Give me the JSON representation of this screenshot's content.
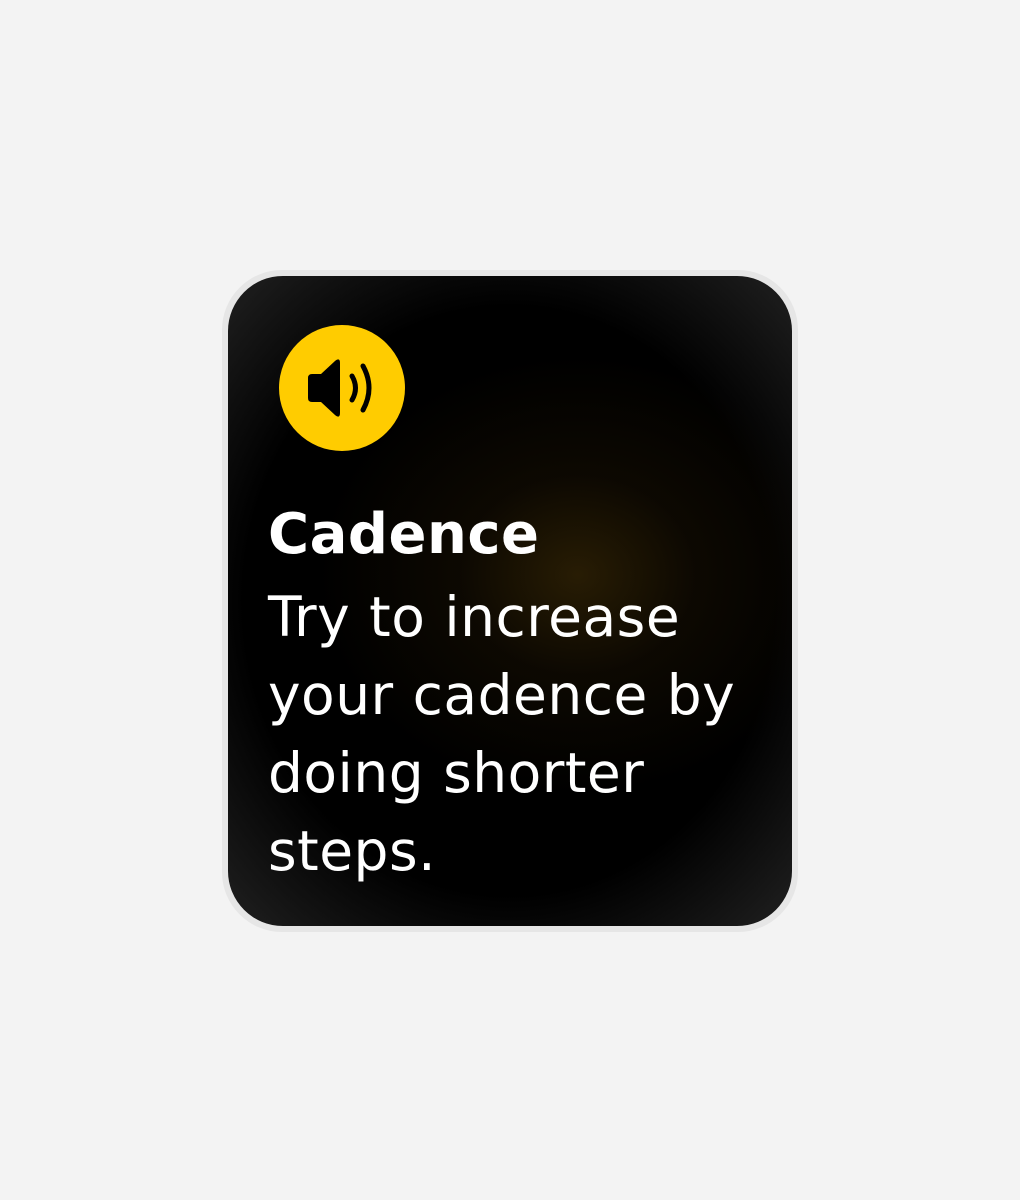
{
  "notification": {
    "icon": "speaker-wave-icon",
    "title": "Cadence",
    "message": "Try to increase your cadence by doing shorter steps."
  },
  "colors": {
    "page_background": "#f3f3f3",
    "bezel": "#e6e6e6",
    "screen": "#000000",
    "accent": "#ffcc00",
    "icon_glyph": "#000000",
    "text": "#ffffff"
  }
}
